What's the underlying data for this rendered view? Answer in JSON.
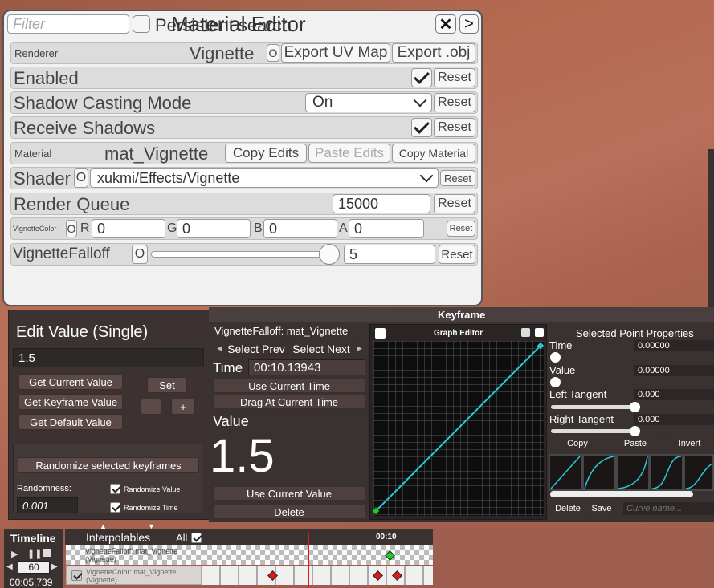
{
  "material_editor": {
    "filter_placeholder": "Filter",
    "persistent_label": "Persistent search",
    "title": "Material Editor",
    "close_glyph": "✕",
    "expand_glyph": ">",
    "renderer": {
      "label": "Renderer",
      "name": "Vignette",
      "o_label": "O",
      "export_uv": "Export UV Map",
      "export_obj": "Export .obj"
    },
    "enabled": {
      "label": "Enabled",
      "checked": true,
      "reset": "Reset"
    },
    "shadow_casting": {
      "label": "Shadow Casting Mode",
      "value": "On",
      "reset": "Reset"
    },
    "receive_shadows": {
      "label": "Receive Shadows",
      "checked": true,
      "reset": "Reset"
    },
    "material": {
      "label": "Material",
      "name": "mat_Vignette",
      "copy_edits": "Copy Edits",
      "paste_edits": "Paste Edits",
      "copy_material": "Copy Material"
    },
    "shader": {
      "label": "Shader",
      "o_label": "O",
      "value": "xukmi/Effects/Vignette",
      "reset": "Reset"
    },
    "render_queue": {
      "label": "Render Queue",
      "value": "15000",
      "reset": "Reset"
    },
    "vignette_color": {
      "label": "VignetteColor",
      "o_label": "O",
      "r_label": "R",
      "r": "0",
      "g_label": "G",
      "g": "0",
      "b_label": "B",
      "b": "0",
      "a_label": "A",
      "a": "0",
      "reset": "Reset"
    },
    "vignette_falloff": {
      "label": "VignetteFalloff",
      "o_label": "O",
      "value": "5",
      "slider_fraction": 0.95,
      "reset": "Reset"
    }
  },
  "edit_value": {
    "title": "Edit Value (Single)",
    "value": "1.5",
    "get_current": "Get Current Value",
    "get_keyframe": "Get Keyframe Value",
    "get_default": "Get Default Value",
    "set": "Set",
    "minus": "-",
    "plus": "+",
    "randomize_btn": "Randomize selected keyframes",
    "randomness_label": "Randomness:",
    "randomness_value": "0.001",
    "randomize_value_label": "Randomize Value",
    "randomize_time_label": "Randomize Time"
  },
  "keyframe": {
    "title": "Keyframe",
    "interpolable_name": "VignetteFalloff: mat_Vignette",
    "select_prev": "Select Prev",
    "select_next": "Select Next",
    "time_label": "Time",
    "time_value": "00:10.13943",
    "use_current_time": "Use Current Time",
    "drag_at_current_time": "Drag At Current Time",
    "value_label": "Value",
    "value_big": "1.5",
    "use_current_value": "Use Current Value",
    "delete": "Delete",
    "graph_editor_title": "Graph Editor",
    "props": {
      "title": "Selected Point Properties",
      "time_label": "Time",
      "time_value": "0.00000",
      "value_label": "Value",
      "value_value": "0.00000",
      "left_tangent_label": "Left Tangent",
      "left_tangent_value": "0.000",
      "right_tangent_label": "Right Tangent",
      "right_tangent_value": "0.000",
      "copy": "Copy",
      "paste": "Paste",
      "invert": "Invert",
      "delete": "Delete",
      "save": "Save",
      "curve_name_placeholder": "Curve name..."
    }
  },
  "timeline": {
    "title": "Timeline",
    "interpolables_label": "Interpolables",
    "all_label": "All",
    "fps": "60",
    "current_time": "00:05.739",
    "time_marker": "00:10",
    "track1_label": "VignetteFalloff: mat_Vignette (Vignette)",
    "track2_label": "VignetteColor: mat_Vignette (Vignette)"
  },
  "colors": {
    "curve": "#27c8d8",
    "playhead": "#e01818",
    "keyframe_red": "#e01818",
    "keyframe_green": "#22cc22"
  }
}
